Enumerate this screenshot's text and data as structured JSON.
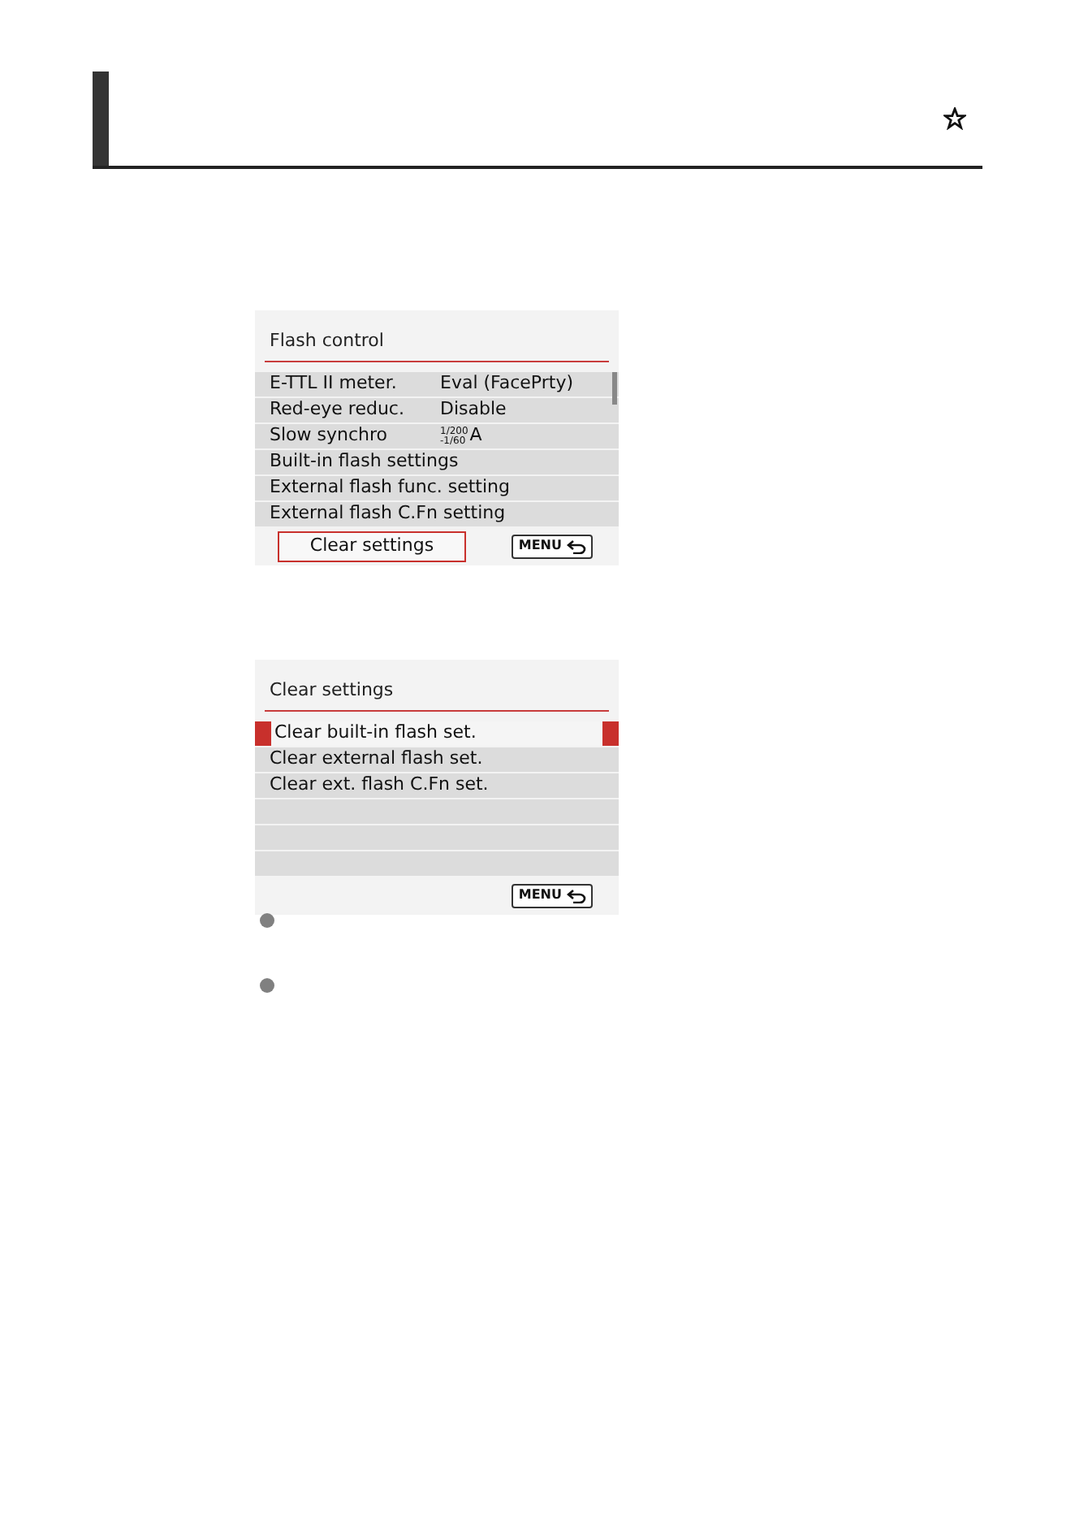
{
  "screens": [
    {
      "title": "Flash control",
      "rows": [
        {
          "kind": "setting",
          "label": "E-TTL II meter.",
          "value": "Eval (FacePrty)",
          "selected": false
        },
        {
          "kind": "setting",
          "label": "Red-eye reduc.",
          "value": "Disable",
          "selected": false
        },
        {
          "kind": "range",
          "label": "Slow synchro",
          "value_top": "1/200",
          "value_bottom": "-1/60",
          "value": "A",
          "selected": false
        },
        {
          "kind": "item",
          "label": "Built-in flash settings",
          "selected": false
        },
        {
          "kind": "item",
          "label": "External flash func. setting",
          "selected": false
        },
        {
          "kind": "item",
          "label": "External flash C.Fn setting",
          "selected": false
        }
      ],
      "scrollbar": true,
      "footer_button": {
        "label": "Clear settings",
        "selected": true
      },
      "menu_key": "MENU"
    },
    {
      "title": "Clear settings",
      "rows": [
        {
          "kind": "item",
          "label": "Clear built-in flash set.",
          "selected": true
        },
        {
          "kind": "item",
          "label": "Clear external flash set.",
          "selected": false
        },
        {
          "kind": "item",
          "label": "Clear ext. flash C.Fn set.",
          "selected": false
        },
        {
          "kind": "empty",
          "selected": false
        },
        {
          "kind": "empty",
          "selected": false
        },
        {
          "kind": "empty",
          "selected": false
        }
      ],
      "menu_key": "MENU"
    }
  ],
  "bullets": [
    {
      "kind": "dot"
    },
    {
      "kind": "dot"
    }
  ]
}
